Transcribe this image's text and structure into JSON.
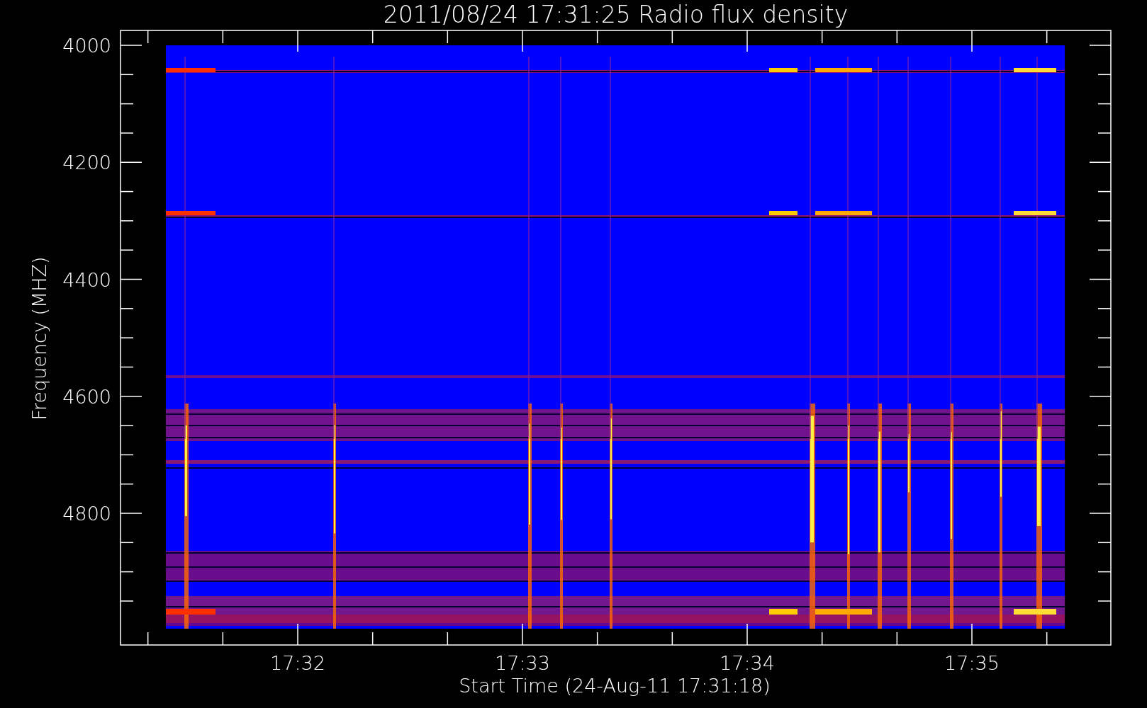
{
  "plot": {
    "title": "2011/08/24 17:31:25 Radio flux density",
    "y_axis": {
      "label": "Frequency (MHZ)",
      "ticks": [
        "4000",
        "4200",
        "4400",
        "4600",
        "4800"
      ]
    },
    "x_axis": {
      "label": "Start Time (24-Aug-11 17:31:18)",
      "ticks": [
        "17:32",
        "17:33",
        "17:34",
        "17:35"
      ]
    }
  }
}
